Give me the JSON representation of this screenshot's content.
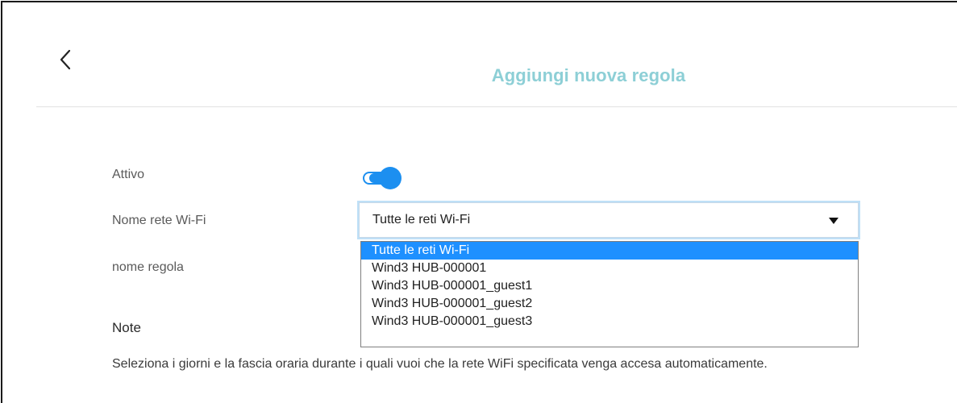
{
  "header": {
    "title": "Aggiungi nuova regola",
    "back_icon": "chevron-left-icon"
  },
  "form": {
    "active_label": "Attivo",
    "active_value": true,
    "wifi_label": "Nome rete Wi-Fi",
    "wifi_selected": "Tutte le reti Wi-Fi",
    "wifi_options": [
      "Tutte le reti Wi-Fi",
      "Wind3 HUB-000001",
      "Wind3 HUB-000001_guest1",
      "Wind3 HUB-000001_guest2",
      "Wind3 HUB-000001_guest3"
    ],
    "rule_name_label": "nome regola",
    "note_label": "Note",
    "note_text": "Seleziona i giorni e la fascia oraria durante i quali vuoi che la rete WiFi specificata venga accesa automaticamente."
  },
  "colors": {
    "title": "#8dcfd6",
    "accent": "#1c8ff0",
    "selected_option": "#1e90ff"
  }
}
